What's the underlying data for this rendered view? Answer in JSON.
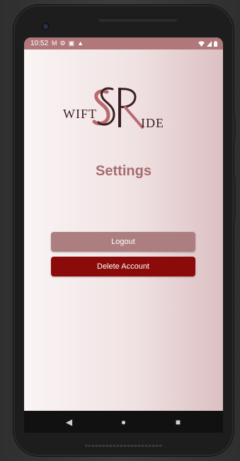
{
  "status_bar": {
    "time": "10:52",
    "left_icons": [
      "gmail-icon",
      "gear-icon",
      "sim-icon",
      "upload-icon"
    ],
    "right_icons": [
      "wifi-icon",
      "signal-icon",
      "battery-icon"
    ]
  },
  "logo": {
    "monogram": "SR",
    "left_text": "WIFT",
    "right_text": "IDE",
    "colors": {
      "dark": "#3b1f22",
      "light": "#b86a6f"
    }
  },
  "page": {
    "title": "Settings"
  },
  "buttons": {
    "logout_label": "Logout",
    "delete_label": "Delete Account"
  },
  "navigation": {
    "back": "◀",
    "home": "●",
    "recents": "■"
  },
  "colors": {
    "status_bar": "#b0787a",
    "title": "#a86b6f",
    "logout_button": "#ad7e80",
    "delete_button": "#8b0a0a"
  }
}
